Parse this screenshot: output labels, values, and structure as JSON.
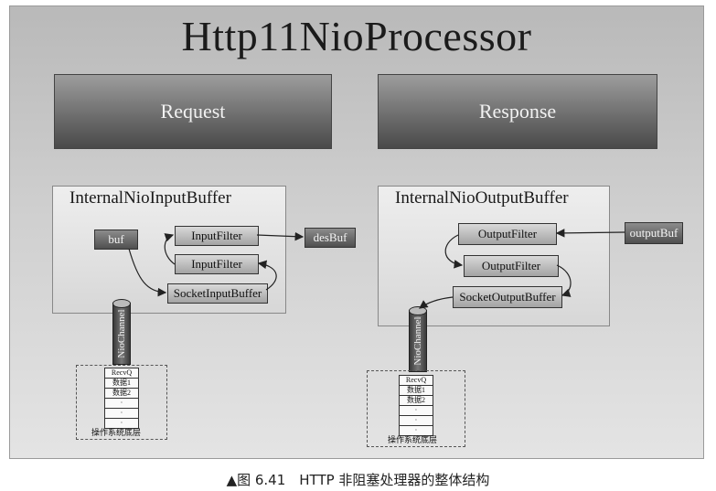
{
  "title": "Http11NioProcessor",
  "request": {
    "banner": "Request",
    "buffer_label": "InternalNioInputBuffer",
    "buf": "buf",
    "filter1": "InputFilter",
    "filter2": "InputFilter",
    "socket_buffer": "SocketInputBuffer",
    "dest": "desBuf",
    "channel": "NioChannel",
    "os_stack": [
      "RecvQ",
      "数据1",
      "数据2",
      "·",
      "·",
      "·"
    ],
    "os_label": "操作系统底层"
  },
  "response": {
    "banner": "Response",
    "buffer_label": "InternalNioOutputBuffer",
    "filter1": "OutputFilter",
    "filter2": "OutputFilter",
    "socket_buffer": "SocketOutputBuffer",
    "source": "outputBuf",
    "channel": "NioChannel",
    "os_stack": [
      "RecvQ",
      "数据1",
      "数据2",
      "·",
      "·",
      "·"
    ],
    "os_label": "操作系统底层"
  },
  "caption": "▲图 6.41　HTTP 非阻塞处理器的整体结构"
}
